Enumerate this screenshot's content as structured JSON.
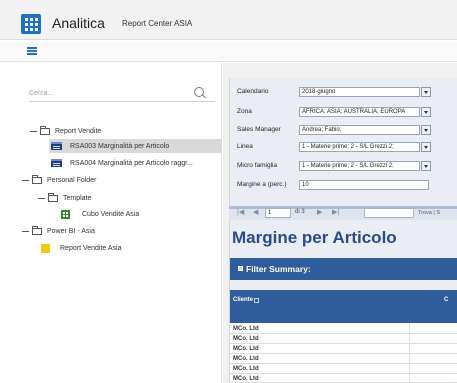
{
  "header": {
    "app_title": "Analitica",
    "subtitle": "Report Center ASIA"
  },
  "icons": {
    "app_grid": "apps-grid-icon",
    "menu": "hamburger-menu-icon",
    "search": "search-icon",
    "folder": "folder-icon",
    "report": "report-icon",
    "cube": "cube-grid-icon",
    "powerbi": "powerbi-icon"
  },
  "colors": {
    "accent": "#1f6fc6",
    "report_header": "#2f5c9a",
    "title_blue": "#2a4a8c",
    "selected_row": "#d9d9d9",
    "powerbi_yellow": "#f2c811",
    "cube_green": "#2f8b2f"
  },
  "sidebar": {
    "search_placeholder": "Cerca...",
    "tree": [
      {
        "label": "Report Vendite",
        "type": "folder"
      },
      {
        "label": "RSA003 Marginalità per Articolo",
        "type": "report",
        "selected": true
      },
      {
        "label": "RSA004 Marginalità per Articolo raggr...",
        "type": "report"
      },
      {
        "label": "Personal Folder",
        "type": "folder"
      },
      {
        "label": "Template",
        "type": "folder"
      },
      {
        "label": "Cubo Vendite Asia",
        "type": "cube"
      },
      {
        "label": "Power BI - Asia",
        "type": "folder"
      },
      {
        "label": "Report Vendite Asia",
        "type": "powerbi"
      }
    ]
  },
  "parameters": [
    {
      "label": "Calendario",
      "value": "2018-giugno"
    },
    {
      "label": "Zona",
      "value": "AFRICA; ASIA; AUSTRALIA; EUROPA"
    },
    {
      "label": "Sales Manager",
      "value": "Andrea; Fabio;"
    },
    {
      "label": "Linea",
      "value": "1 - Materie prime; 2 - S/L Grezzi 2;"
    },
    {
      "label": "Micro famiglia",
      "value": "1 - Materie prime; 2 - S/L Grezzi 2;"
    },
    {
      "label": "Margine a (perc.)",
      "value": "10"
    }
  ],
  "navigation": {
    "first": "|◀",
    "prev": "◀",
    "page": "1",
    "of_pages": "di 3",
    "next": "▶",
    "last": "▶|",
    "find": "Trova | S"
  },
  "report": {
    "title": "Margine per Articolo",
    "filter_summary": "Filter Summary:",
    "columns": [
      "Cliente",
      "C"
    ],
    "rows": [
      "MCo. Ltd",
      "MCo. Ltd",
      "MCo. Ltd",
      "MCo. Ltd",
      "MCo. Ltd",
      "MCo. Ltd"
    ]
  }
}
